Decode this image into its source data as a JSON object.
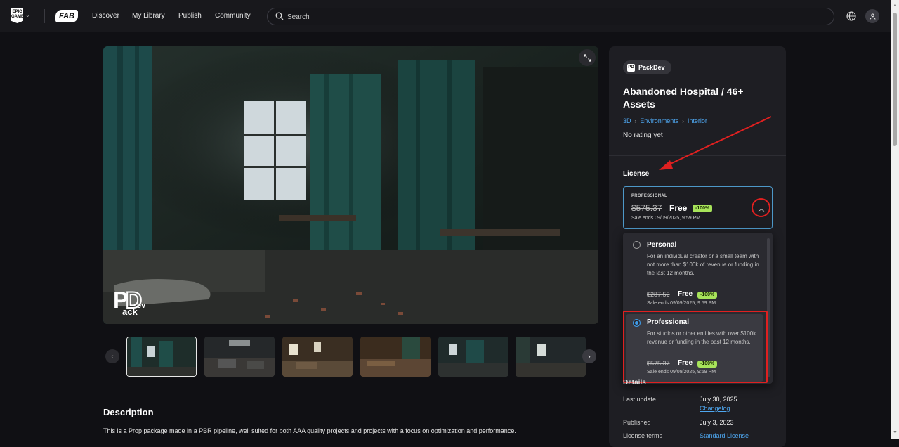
{
  "topbar": {
    "epic_logo_text": "EPIC GAMES",
    "fab_logo_text": "FAB",
    "nav": [
      "Discover",
      "My Library",
      "Publish",
      "Community"
    ],
    "search_placeholder": "Search"
  },
  "gallery": {
    "watermark": "PackDev",
    "thumbnail_count": 6,
    "active_thumbnail": 1
  },
  "description": {
    "title": "Description",
    "text": "This is a Prop package made in a PBR pipeline, well suited for both AAA quality projects and projects with a focus on optimization and performance."
  },
  "product": {
    "seller": "PackDev",
    "title": "Abandoned Hospital / 46+ Assets",
    "breadcrumbs": [
      "3D",
      "Environments",
      "Interior"
    ],
    "rating": "No rating yet"
  },
  "license": {
    "label": "License",
    "selected": {
      "tier": "PROFESSIONAL",
      "original_price": "$575.37",
      "price": "Free",
      "discount": "-100%",
      "sale_ends": "Sale ends 09/09/2025, 9:59 PM"
    },
    "options": [
      {
        "name": "Personal",
        "description": "For an individual creator or a small team with not more than $100k of revenue or funding in the last 12 months.",
        "original_price": "$287.52",
        "price": "Free",
        "discount": "-100%",
        "sale_ends": "Sale ends 09/09/2025, 9:59 PM",
        "checked": false
      },
      {
        "name": "Professional",
        "description": "For studios or other entities with over $100k revenue or funding in the past 12 months.",
        "original_price": "$575.37",
        "price": "Free",
        "discount": "-100%",
        "sale_ends": "Sale ends 09/09/2025, 9:59 PM",
        "checked": true
      }
    ]
  },
  "details": {
    "header": "Details",
    "rows": [
      {
        "label": "Last update",
        "value": "July 30, 2025",
        "link": "Changelog"
      },
      {
        "label": "Published",
        "value": "July 3, 2023"
      },
      {
        "label": "License terms",
        "link": "Standard License"
      }
    ]
  },
  "colors": {
    "background": "#101014",
    "panel": "#1e1e23",
    "link": "#4ea7f0",
    "discount_badge": "#a7e35a",
    "annotation": "#e02020",
    "selected_border": "#4d98c8"
  }
}
